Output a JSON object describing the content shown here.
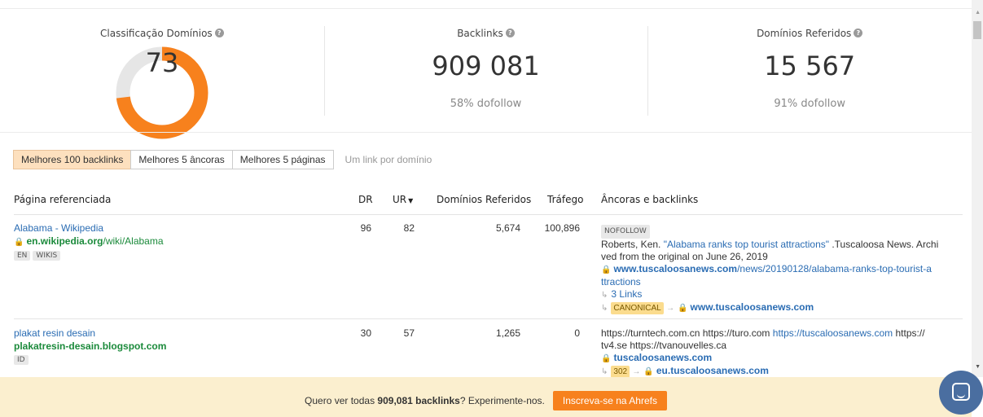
{
  "stats": {
    "domain_rating": {
      "label": "Classificação Domínios",
      "value": "73",
      "score": 73
    },
    "backlinks": {
      "label": "Backlinks",
      "value": "909 081",
      "sub": "58% dofollow"
    },
    "referring_domains": {
      "label": "Domínios Referidos",
      "value": "15 567",
      "sub": "91% dofollow"
    }
  },
  "colors": {
    "donut_fill": "#f7811d",
    "donut_track": "#e6e6e6",
    "accent": "#f7811d",
    "link": "#2a6cb3",
    "url": "#1b8a3b"
  },
  "tabs": [
    {
      "label": "Melhores 100 backlinks",
      "active": true
    },
    {
      "label": "Melhores 5 âncoras",
      "active": false
    },
    {
      "label": "Melhores 5 páginas",
      "active": false
    }
  ],
  "tab_hint": "Um link por domínio",
  "table": {
    "headers": {
      "page": "Página referenciada",
      "dr": "DR",
      "ur": "UR",
      "ur_sort_icon": "caret-down-icon",
      "ref_domains": "Domínios Referidos",
      "traffic": "Tráfego",
      "anchors": "Âncoras e backlinks"
    },
    "rows": [
      {
        "title": "Alabama - Wikipedia",
        "url_domain": "en.wikipedia.org",
        "url_path": "/wiki/Alabama",
        "tags": [
          "EN",
          "WIKIS"
        ],
        "dr": "96",
        "ur": "82",
        "ref_domains": "5,674",
        "traffic": "100,896",
        "badge": "NOFOLLOW",
        "text_before": "Roberts, Ken. ",
        "anchor": "\"Alabama ranks top tourist attractions\"",
        "text_after": " .Tuscaloosa News. Archi ved from the original on June 26, 2019",
        "link_domain": "www.tuscaloosanews.com",
        "link_path": "/news/20190128/alabama-ranks-top-tourist-a ttractions",
        "links_count": "3 Links",
        "redirect_tag": "CANONICAL",
        "redirect_target": "www.tuscaloosanews.com"
      },
      {
        "title": "plakat resin desain",
        "url_domain": "plakatresin-desain.blogspot.com",
        "tags": [
          "ID"
        ],
        "dr": "30",
        "ur": "57",
        "ref_domains": "1,265",
        "traffic": "0",
        "text_before": "https://turntech.com.cn https://turo.com ",
        "anchor": "https://tuscaloosanews.com",
        "text_after": " https:// tv4.se https://tvanouvelles.ca",
        "link_domain": "tuscaloosanews.com",
        "redirect_tag": "302",
        "redirect_target": "eu.tuscaloosanews.com"
      }
    ]
  },
  "banner": {
    "prefix": "Quero ver todas ",
    "count": "909,081 backlinks",
    "suffix": "? Experimente-nos.",
    "button": "Inscreva-se na Ahrefs"
  }
}
